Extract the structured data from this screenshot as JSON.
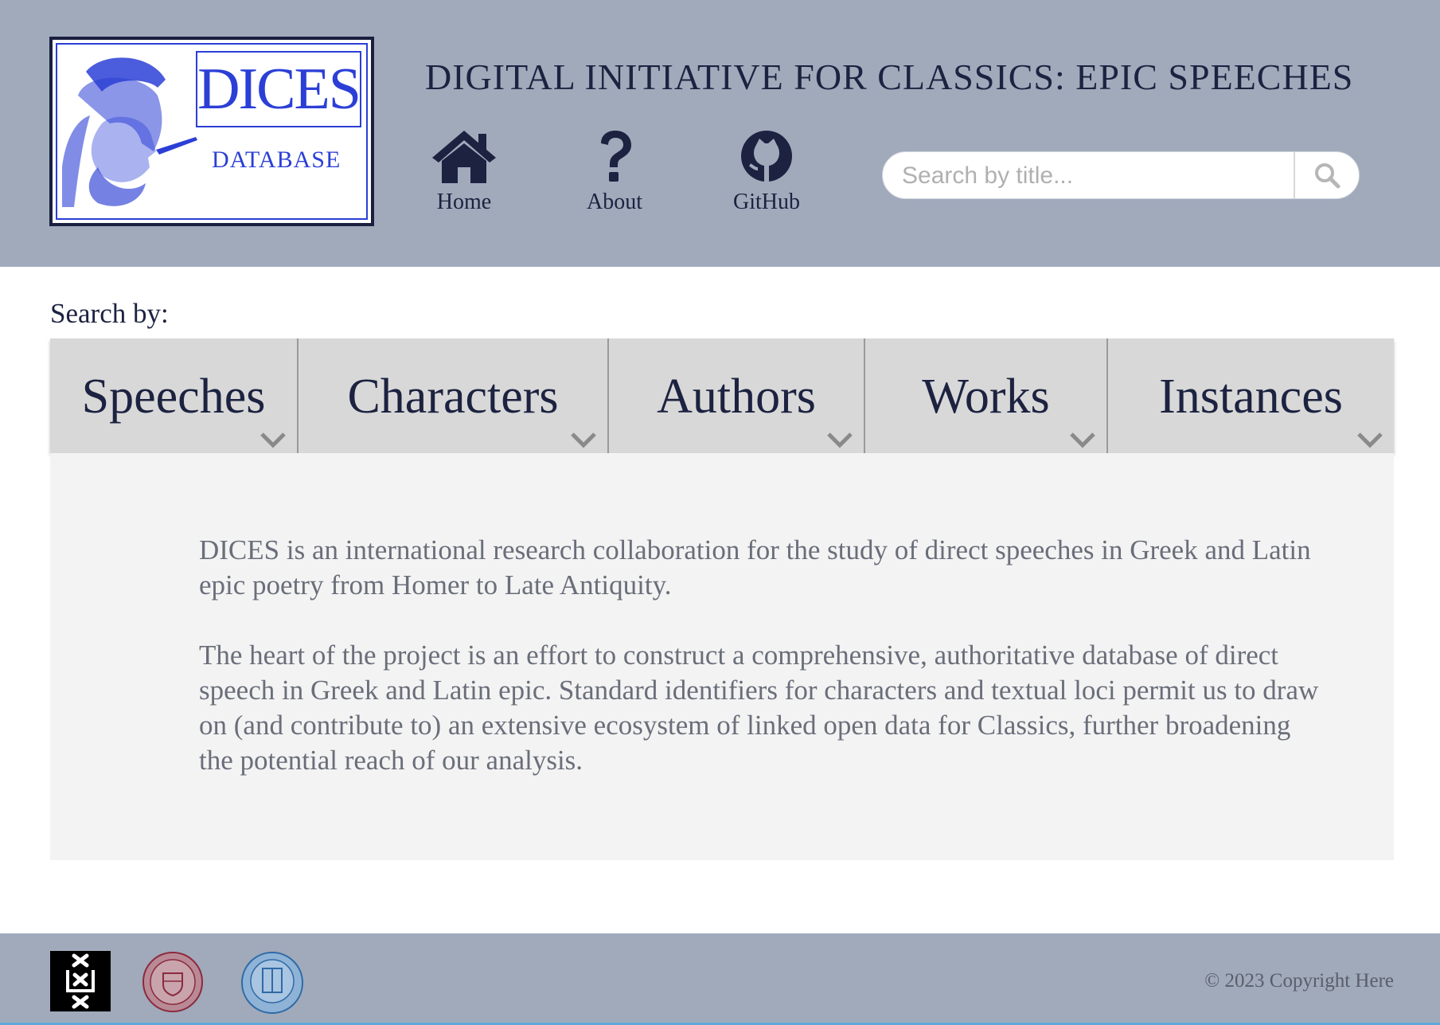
{
  "header": {
    "logo": {
      "main": "DICES",
      "sub": "DATABASE"
    },
    "title": "DIGITAL INITIATIVE FOR CLASSICS: EPIC SPEECHES",
    "nav": [
      {
        "label": "Home",
        "icon": "home-icon"
      },
      {
        "label": "About",
        "icon": "question-mark-icon"
      },
      {
        "label": "GitHub",
        "icon": "github-icon"
      }
    ],
    "search": {
      "placeholder": "Search by title...",
      "value": "",
      "icon": "search-icon"
    }
  },
  "main": {
    "search_by_label": "Search by:",
    "tabs": [
      {
        "label": "Speeches"
      },
      {
        "label": "Characters"
      },
      {
        "label": "Authors"
      },
      {
        "label": "Works"
      },
      {
        "label": "Instances"
      }
    ],
    "paragraphs": [
      "DICES is an international research collaboration for the study of direct speeches in Greek and Latin epic poetry from Homer to Late Antiquity.",
      "The heart of the project is an effort to construct a comprehensive, authoritative database of direct speech in Greek and Latin epic. Standard identifiers for characters and textual loci permit us to draw on (and contribute to) an extensive ecosystem of linked open data for Classics, further broadening the potential reach of our analysis."
    ]
  },
  "footer": {
    "copyright": "© 2023 Copyright Here"
  },
  "colors": {
    "header_bg": "#a0aabb",
    "accent_text": "#1c2240",
    "logo_blue": "#2b3fd6",
    "tab_bg": "#d8d8d8",
    "content_bg": "#f3f3f3"
  }
}
